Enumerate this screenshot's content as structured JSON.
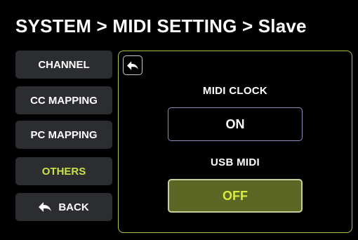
{
  "header": {
    "title": "SYSTEM  >  MIDI SETTING > Slave"
  },
  "sidebar": {
    "items": [
      {
        "label": "CHANNEL",
        "active": false
      },
      {
        "label": "CC MAPPING",
        "active": false
      },
      {
        "label": "PC MAPPING",
        "active": false
      },
      {
        "label": "OTHERS",
        "active": true
      }
    ],
    "back_label": "BACK"
  },
  "panel": {
    "back_icon": "back-arrow-icon",
    "midi_clock": {
      "label": "MIDI CLOCK",
      "value": "ON"
    },
    "usb_midi": {
      "label": "USB MIDI",
      "value": "OFF"
    }
  },
  "colors": {
    "accent": "#cde04a",
    "panel_border": "#a9c84a",
    "button_bg": "#2b2d30",
    "off_bg": "#5c6625",
    "on_border": "#8d8dc0"
  }
}
